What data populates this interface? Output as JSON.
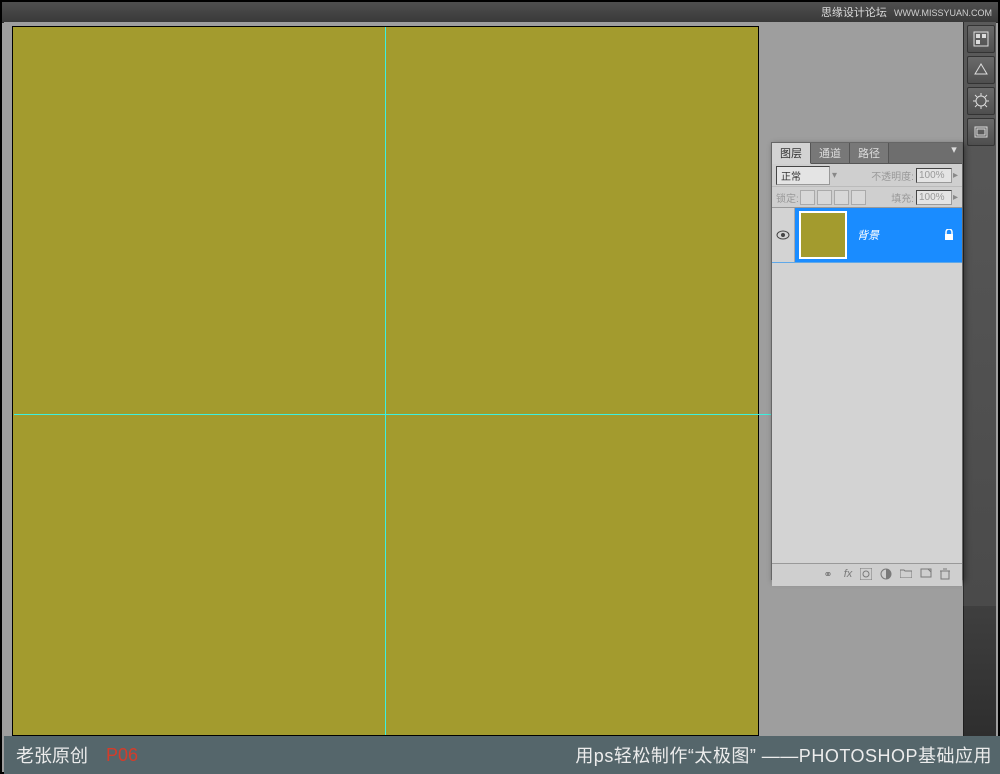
{
  "watermark": {
    "site": "思缘设计论坛",
    "url": "WWW.MISSYUAN.COM"
  },
  "layers_panel": {
    "tabs": {
      "layers": "图层",
      "channels": "通道",
      "paths": "路径"
    },
    "blend_mode": "正常",
    "opacity_label": "不透明度:",
    "opacity_value": "100%",
    "lock_label": "锁定:",
    "fill_label": "填充:",
    "fill_value": "100%",
    "layer_name": "背景"
  },
  "caption": {
    "author": "老张原创",
    "page": "P06",
    "title": "用ps轻松制作“太极图” ——PHOTOSHOP基础应用"
  },
  "icons": {
    "swatches": "swatches",
    "styles": "styles",
    "adjustments": "adjustments",
    "history": "history",
    "link": "link",
    "fx": "fx",
    "mask": "mask",
    "adj": "adj",
    "group": "group",
    "new": "new",
    "trash": "trash"
  }
}
